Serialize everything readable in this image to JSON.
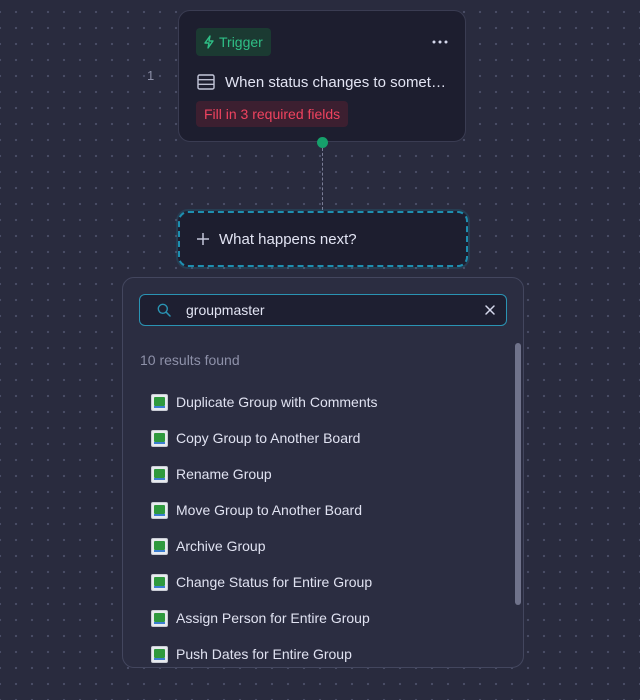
{
  "canvas": {
    "step_number": "1"
  },
  "trigger": {
    "badge_label": "Trigger",
    "title": "When status changes to something",
    "warning": "Fill in 3 required fields",
    "badge_color": "#2fbf86",
    "warning_color": "#f0435f",
    "icons": {
      "badge": "bolt-icon",
      "more": "more-horizontal-icon",
      "title": "table-icon"
    }
  },
  "next_step": {
    "label": "What happens next?",
    "icon": "plus-icon",
    "border_color": "#1e8fb0"
  },
  "search": {
    "value": "groupmaster",
    "placeholder": "",
    "results_count": "10 results found",
    "icons": {
      "search": "search-icon",
      "clear": "close-icon"
    },
    "accent_color": "#2a93b3"
  },
  "results": [
    {
      "label": "Duplicate Group with Comments",
      "icon": "groupmaster-app-icon"
    },
    {
      "label": "Copy Group to Another Board",
      "icon": "groupmaster-app-icon"
    },
    {
      "label": "Rename Group",
      "icon": "groupmaster-app-icon"
    },
    {
      "label": "Move Group to Another Board",
      "icon": "groupmaster-app-icon"
    },
    {
      "label": "Archive Group",
      "icon": "groupmaster-app-icon"
    },
    {
      "label": "Change Status for Entire Group",
      "icon": "groupmaster-app-icon"
    },
    {
      "label": "Assign Person for Entire Group",
      "icon": "groupmaster-app-icon"
    },
    {
      "label": "Push Dates for Entire Group",
      "icon": "groupmaster-app-icon"
    }
  ]
}
